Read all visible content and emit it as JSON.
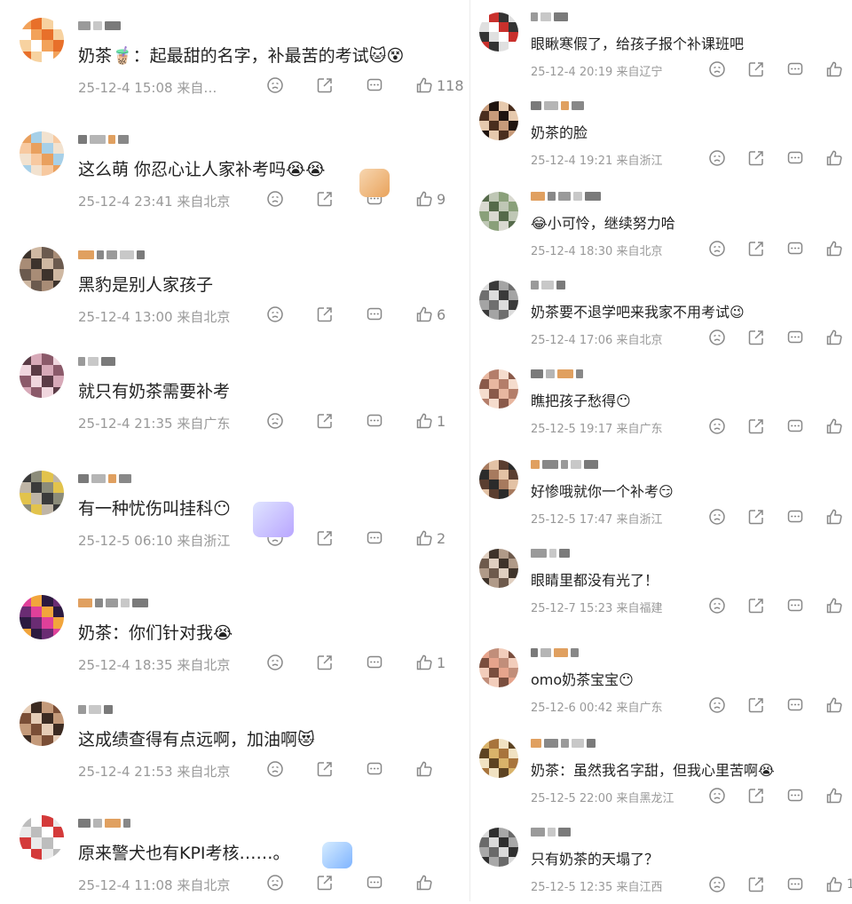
{
  "colors": {
    "text": "#222222",
    "meta": "#999999",
    "icon": "#888888",
    "emoji": "#f5c842"
  },
  "icons": [
    "dislike-icon",
    "share-icon",
    "reply-icon",
    "like-icon"
  ],
  "left": [
    {
      "text": "奶茶🧋：起最甜的名字，补最苦的考试🐱😵",
      "date": "25-12-4 15:08",
      "location": "来自…",
      "likes": "118"
    },
    {
      "text": "这么萌 你忍心让人家补考吗😭😭",
      "date": "25-12-4 23:41",
      "location": "来自北京",
      "likes": "9"
    },
    {
      "text": "黑豹是别人家孩子",
      "date": "25-12-4 13:00",
      "location": "来自北京",
      "likes": "6"
    },
    {
      "text": "就只有奶茶需要补考",
      "date": "25-12-4 21:35",
      "location": "来自广东",
      "likes": "1"
    },
    {
      "text": "有一种忧伤叫挂科😶",
      "date": "25-12-5 06:10",
      "location": "来自浙江",
      "likes": "2"
    },
    {
      "text": "奶茶：你们针对我😭",
      "date": "25-12-4 18:35",
      "location": "来自北京",
      "likes": "1"
    },
    {
      "text": "这成绩查得有点远啊，加油啊😻",
      "date": "25-12-4 21:53",
      "location": "来自北京",
      "likes": ""
    },
    {
      "text": "原来警犬也有KPI考核……。",
      "date": "25-12-4 11:08",
      "location": "来自北京",
      "likes": ""
    }
  ],
  "right": [
    {
      "text": "眼瞅寒假了，给孩子报个补课班吧",
      "date": "25-12-4 20:19",
      "location": "来自辽宁",
      "likes": ""
    },
    {
      "text": "奶茶的脸",
      "date": "25-12-4 19:21",
      "location": "来自浙江",
      "likes": ""
    },
    {
      "text": "😂小可怜，继续努力哈",
      "date": "25-12-4 18:30",
      "location": "来自北京",
      "likes": ""
    },
    {
      "text": "奶茶要不退学吧来我家不用考试😉",
      "date": "25-12-4 17:06",
      "location": "来自北京",
      "likes": ""
    },
    {
      "text": "瞧把孩子愁得😶",
      "date": "25-12-5 19:17",
      "location": "来自广东",
      "likes": ""
    },
    {
      "text": "好惨哦就你一个补考😏",
      "date": "25-12-5 17:47",
      "location": "来自浙江",
      "likes": ""
    },
    {
      "text": "眼睛里都没有光了！",
      "date": "25-12-7 15:23",
      "location": "来自福建",
      "likes": ""
    },
    {
      "text": "omo奶茶宝宝😶",
      "date": "25-12-6 00:42",
      "location": "来自广东",
      "likes": ""
    },
    {
      "text": "奶茶：虽然我名字甜，但我心里苦啊😭",
      "date": "25-12-5 22:00",
      "location": "来自黑龙江",
      "likes": ""
    },
    {
      "text": "只有奶茶的天塌了？",
      "date": "25-12-5 12:35",
      "location": "来自江西",
      "likes": "1"
    }
  ]
}
